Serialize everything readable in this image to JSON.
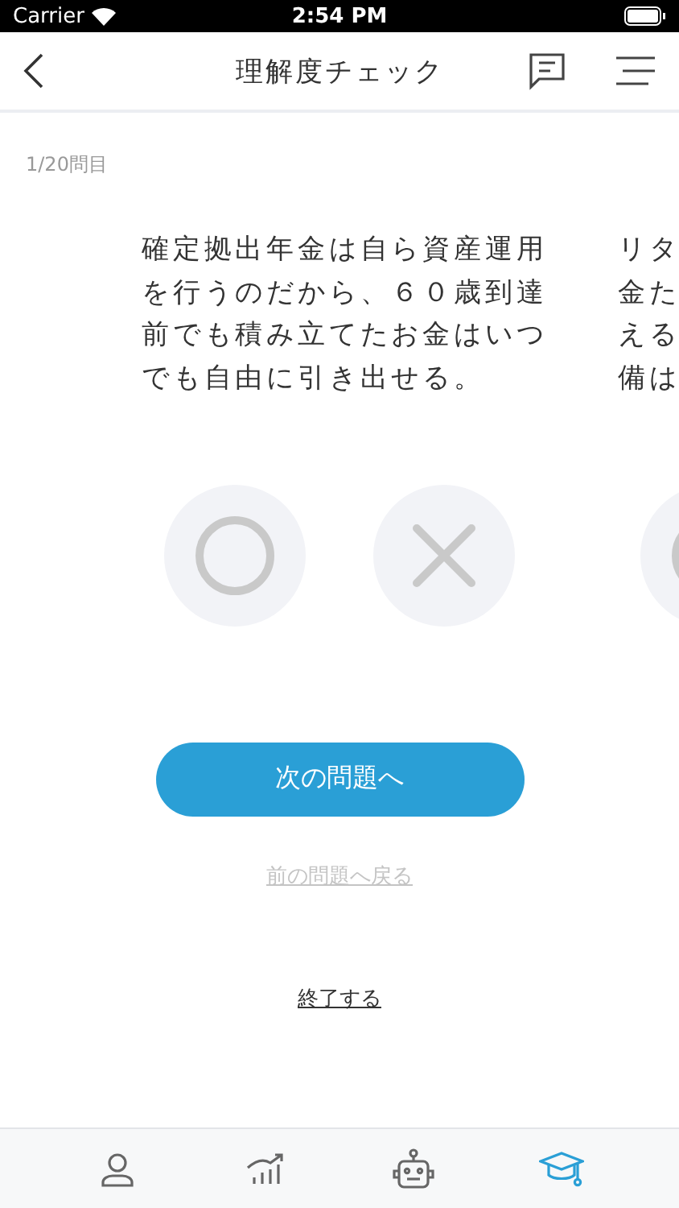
{
  "status_bar": {
    "carrier": "Carrier",
    "time": "2:54 PM"
  },
  "nav": {
    "title": "理解度チェック"
  },
  "progress": "1/20問目",
  "questions": [
    {
      "lines": [
        "確定拠出年金は自ら資産運用",
        "を行うのだから、６０歳到達",
        "前でも積み立てたお金はいつ",
        "でも自由に引き出せる。"
      ],
      "answers": [
        {
          "kind": "maru"
        },
        {
          "kind": "batsu"
        }
      ]
    },
    {
      "lines": [
        "リタ",
        "金た",
        "える",
        "備は"
      ],
      "answers": [
        {
          "kind": "maru"
        }
      ]
    }
  ],
  "next_button": "次の問題へ",
  "prev_link": {
    "label": "前の問題へ戻る",
    "disabled": true
  },
  "finish_link": "終了する",
  "tab_bar": [
    {
      "kind": "person",
      "selected": false
    },
    {
      "kind": "chart",
      "selected": false
    },
    {
      "kind": "robot",
      "selected": false
    },
    {
      "kind": "learn",
      "selected": true
    }
  ]
}
